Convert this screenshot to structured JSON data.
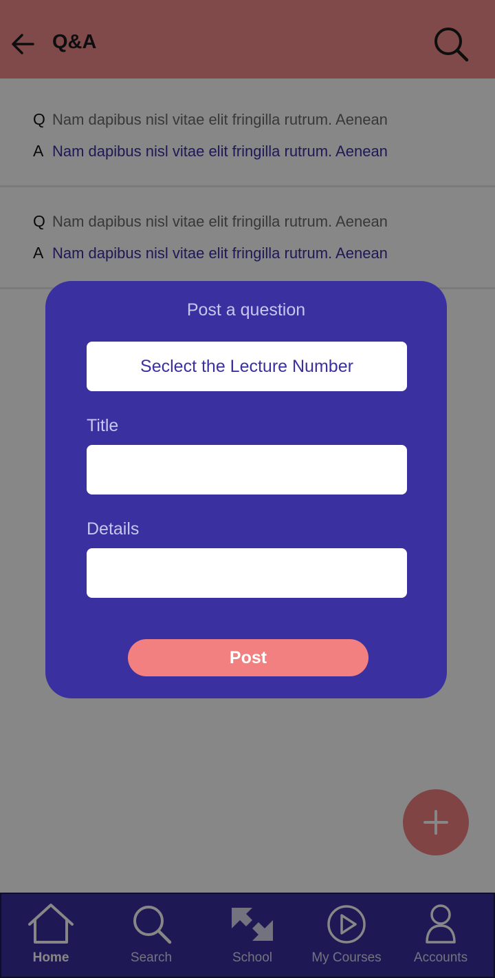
{
  "header": {
    "title": "Q&A",
    "back_icon": "arrow-left-icon",
    "search_icon": "search-icon"
  },
  "qa_list": [
    {
      "q_mark": "Q",
      "question": "Nam dapibus nisl vitae elit fringilla rutrum. Aenean",
      "a_mark": "A",
      "answer": "Nam dapibus nisl vitae elit fringilla rutrum. Aenean"
    },
    {
      "q_mark": "Q",
      "question": "Nam dapibus nisl vitae elit fringilla rutrum. Aenean",
      "a_mark": "A",
      "answer": "Nam dapibus nisl vitae elit fringilla rutrum. Aenean"
    }
  ],
  "modal": {
    "title": "Post a question",
    "lecture_select": "Seclect the Lecture Number",
    "title_label": "Title",
    "title_value": "",
    "details_label": "Details",
    "details_value": "",
    "post_label": "Post"
  },
  "fab": {
    "icon": "plus-icon"
  },
  "bottom_nav": {
    "items": [
      {
        "label": "Home",
        "icon": "home-icon",
        "active": true
      },
      {
        "label": "Search",
        "icon": "search-icon",
        "active": false
      },
      {
        "label": "School",
        "icon": "expand-arrows-icon",
        "active": false
      },
      {
        "label": "My Courses",
        "icon": "play-circle-icon",
        "active": false
      },
      {
        "label": "Accounts",
        "icon": "user-icon",
        "active": false
      }
    ]
  },
  "colors": {
    "header_bg": "#f28c8c",
    "primary": "#3a30a0",
    "accent": "#f28080",
    "answer_text": "#3a30a0",
    "overlay": "rgba(0,0,0,0.47)"
  }
}
